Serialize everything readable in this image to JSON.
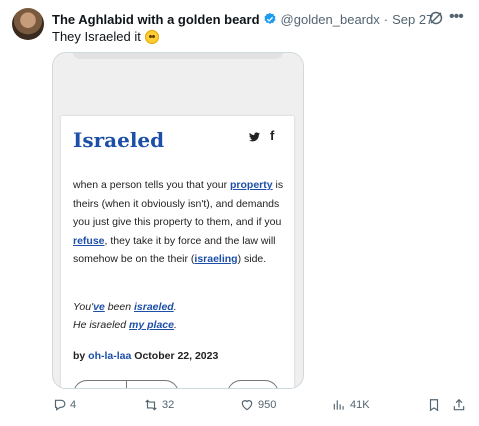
{
  "tweet": {
    "author_name": "The Aghlabid with a golden beard",
    "handle": "@golden_beardx",
    "separator": "·",
    "date": "Sep 27",
    "text": "They Israeled it"
  },
  "media": {
    "title": "Israeled",
    "social_icons": {
      "twitter": "𝕏",
      "facebook": "f"
    },
    "definition": {
      "t1": "when a person tells you that your ",
      "l1": "property",
      "t2": " is theirs (when it obviously isn't), and demands you just give this property to them, and if you ",
      "l2": "refuse",
      "t3": ", they take it by force and the law will somehow be on the their (",
      "l3": "israeling",
      "t4": ") side."
    },
    "example": {
      "t1": "You'",
      "l1": "ve",
      "t2": " been ",
      "l2": "israeled",
      "t3": ".",
      "t4": "He israeled ",
      "l3": "my place",
      "t5": "."
    },
    "byline": {
      "by": "by ",
      "author": "oh-la-laa",
      "date": " October 22, 2023"
    }
  },
  "actions": {
    "replies": "4",
    "reposts": "32",
    "likes": "950",
    "views": "41K"
  },
  "colors": {
    "link_blue": "#1d4fa8",
    "verified_blue": "#1d9bf0",
    "muted": "#536471"
  }
}
